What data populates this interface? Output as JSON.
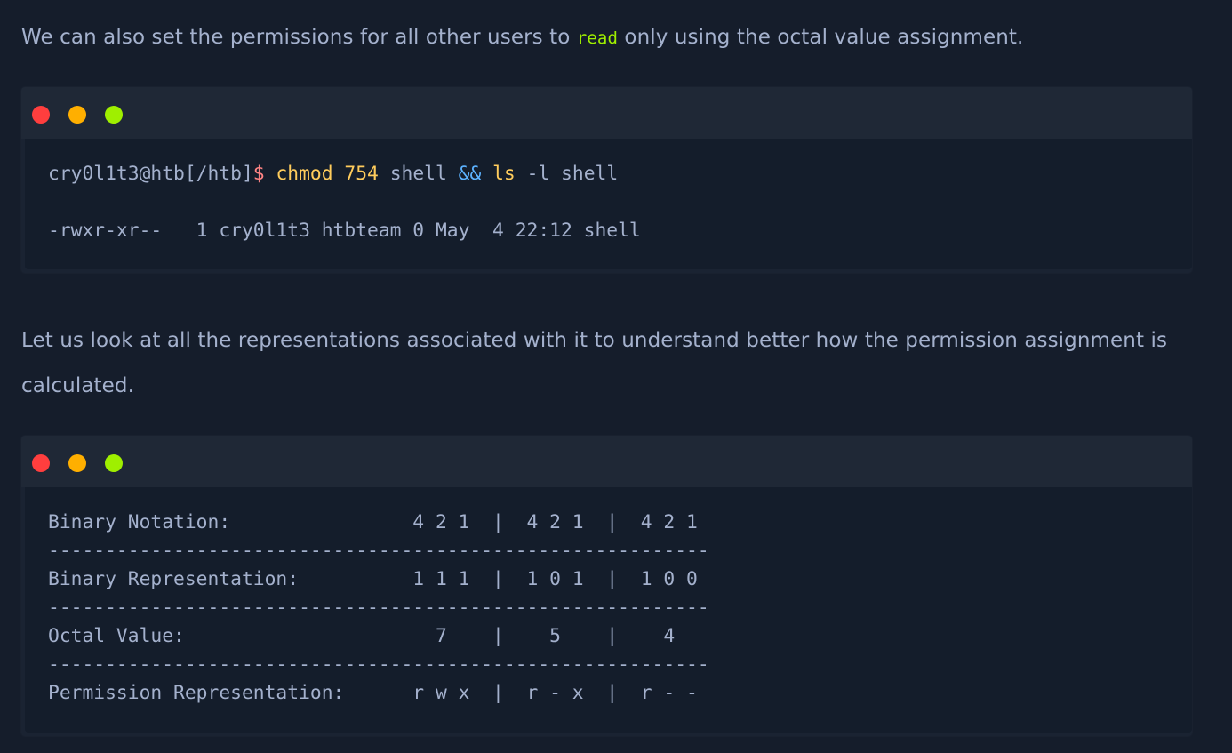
{
  "paragraph1": {
    "before": "We can also set the permissions for all other users to ",
    "code": "read",
    "after": " only using the octal value assignment."
  },
  "terminal1": {
    "prompt": "cry0l1t3@htb[/htb]",
    "dollar": "$",
    "cmd": "chmod",
    "num": "754",
    "arg1": "shell",
    "op": "&&",
    "ls": "ls",
    "arg2": "-l shell",
    "output": "-rwxr-xr--   1 cry0l1t3 htbteam 0 May  4 22:12 shell"
  },
  "paragraph2": {
    "text": "Let us look at all the representations associated with it to understand better how the permission assignment is calculated."
  },
  "terminal2": {
    "lines": [
      "Binary Notation:                4 2 1  |  4 2 1  |  4 2 1",
      "----------------------------------------------------------",
      "Binary Representation:          1 1 1  |  1 0 1  |  1 0 0",
      "----------------------------------------------------------",
      "Octal Value:                      7    |    5    |    4",
      "----------------------------------------------------------",
      "Permission Representation:      r w x  |  r - x  |  r - -"
    ]
  },
  "colors": {
    "background": "#151d2b",
    "text": "#a4b1cd",
    "inline_code": "#9fef00",
    "dot_red": "#ff3e3e",
    "dot_yellow": "#ffaf00",
    "dot_green": "#9fef00",
    "prompt_dollar": "#ff8484",
    "command": "#ffcc5c",
    "operator": "#5cb2ff"
  },
  "icons": {
    "window_close": "window-close-dot-icon",
    "window_minimize": "window-minimize-dot-icon",
    "window_maximize": "window-maximize-dot-icon"
  }
}
